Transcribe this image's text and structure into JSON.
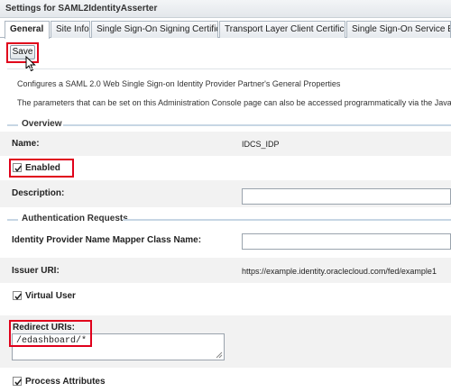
{
  "window": {
    "title": "Settings for SAML2IdentityAsserter"
  },
  "tabs": [
    {
      "label": "General",
      "active": true
    },
    {
      "label": "Site Info"
    },
    {
      "label": "Single Sign-On Signing Certificate"
    },
    {
      "label": "Transport Layer Client Certificate"
    },
    {
      "label": "Single Sign-On Service Endpo"
    }
  ],
  "toolbar": {
    "save_label": "Save"
  },
  "intro": {
    "line1": "Configures a SAML 2.0 Web Single Sign-on Identity Provider Partner's General Properties",
    "line2": "The parameters that can be set on this Administration Console page can also be accessed programmatically via the Java interf"
  },
  "sections": {
    "overview": "Overview",
    "auth_requests": "Authentication Requests"
  },
  "fields": {
    "name": {
      "label": "Name:",
      "value": "IDCS_IDP"
    },
    "enabled": {
      "label": "Enabled",
      "checked": true
    },
    "description": {
      "label": "Description:",
      "value": ""
    },
    "mapper_class": {
      "label": "Identity Provider Name Mapper Class Name:",
      "value": ""
    },
    "issuer_uri": {
      "label": "Issuer URI:",
      "value": "https://example.identity.oraclecloud.com/fed/example1"
    },
    "virtual_user": {
      "label": "Virtual User",
      "checked": true
    },
    "redirect_uris": {
      "label": "Redirect URIs:",
      "value": "/edashboard/*"
    },
    "process_attributes": {
      "label": "Process Attributes",
      "checked": true
    }
  },
  "colors": {
    "highlight": "#e0001b",
    "section_rule": "#c7d6e4",
    "alt_row": "#f2f2f2"
  },
  "icons": {
    "cursor": "mouse-pointer-icon",
    "checkbox": "checkmark-icon",
    "resize": "resize-grip-icon"
  }
}
